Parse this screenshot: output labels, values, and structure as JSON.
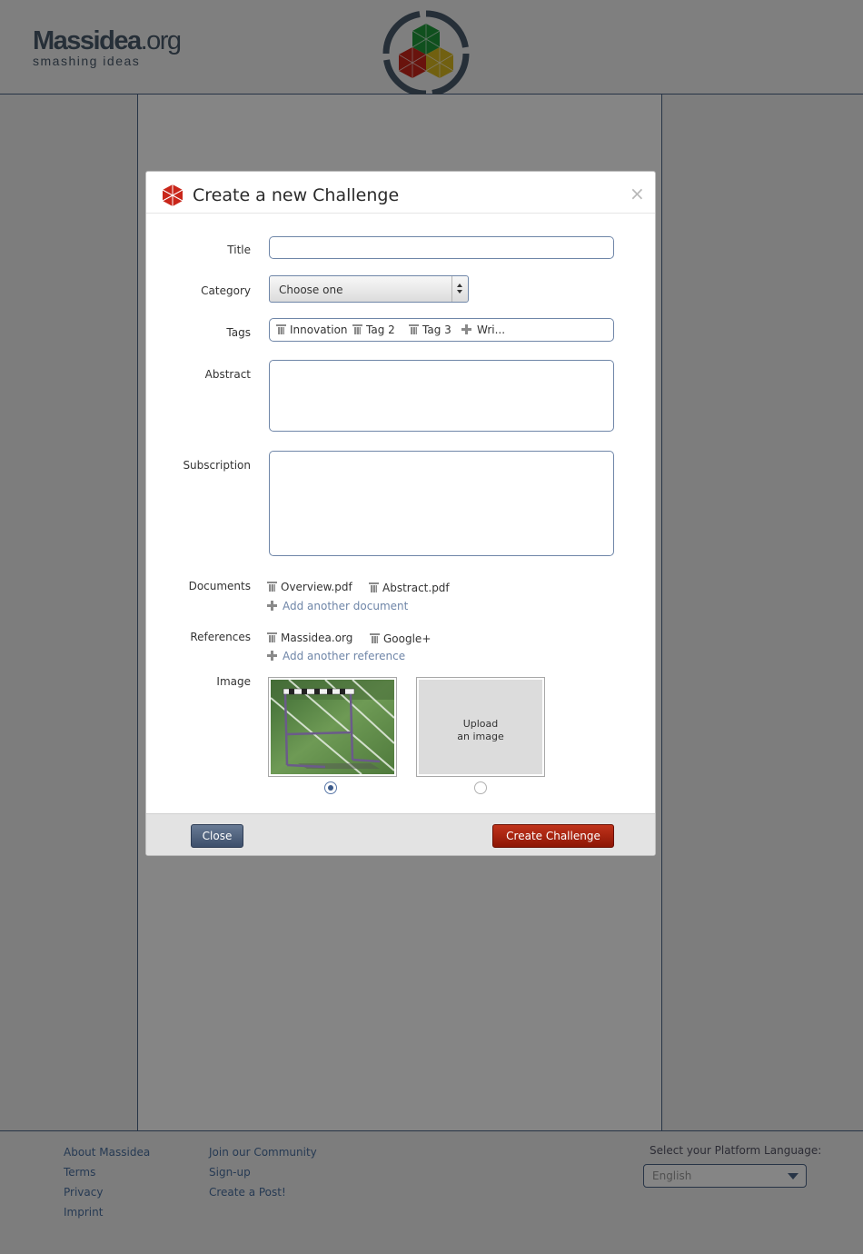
{
  "site": {
    "logo_main": "Massidea",
    "logo_suffix": ".org",
    "logo_tagline": "smashing ideas"
  },
  "modal": {
    "title": "Create a new Challenge",
    "close_symbol": "×",
    "labels": {
      "title": "Title",
      "category": "Category",
      "tags": "Tags",
      "abstract": "Abstract",
      "subscription": "Subscription",
      "documents": "Documents",
      "references": "References",
      "image": "Image"
    },
    "title_value": "",
    "category_selected": "Choose one",
    "tags": [
      "Innovation",
      "Tag 2",
      "Tag 3"
    ],
    "tag_input_placeholder": "Wri...",
    "abstract_value": "",
    "subscription_value": "",
    "documents": [
      "Overview.pdf",
      "Abstract.pdf"
    ],
    "add_document_label": "Add another document",
    "references": [
      "Massidea.org",
      "Google+"
    ],
    "add_reference_label": "Add another reference",
    "upload_line1": "Upload",
    "upload_line2": "an image",
    "selected_image": "uploaded-hurdle-photo",
    "close_button": "Close",
    "create_button": "Create Challenge"
  },
  "footer": {
    "col1": [
      "About Massidea",
      "Terms",
      "Privacy",
      "Imprint"
    ],
    "col2": [
      "Join our Community",
      "Sign-up",
      "Create a Post!"
    ],
    "language_label": "Select your Platform Language:",
    "language_value": "English"
  },
  "colors": {
    "primary_button": "#a11f0b",
    "secondary_button": "#4a5c78",
    "field_border": "#6f86a8",
    "overlay": "rgba(0,0,0,0.48)"
  },
  "icons": [
    "trash-icon",
    "plus-icon",
    "close-icon",
    "massidea-cube-icon"
  ]
}
